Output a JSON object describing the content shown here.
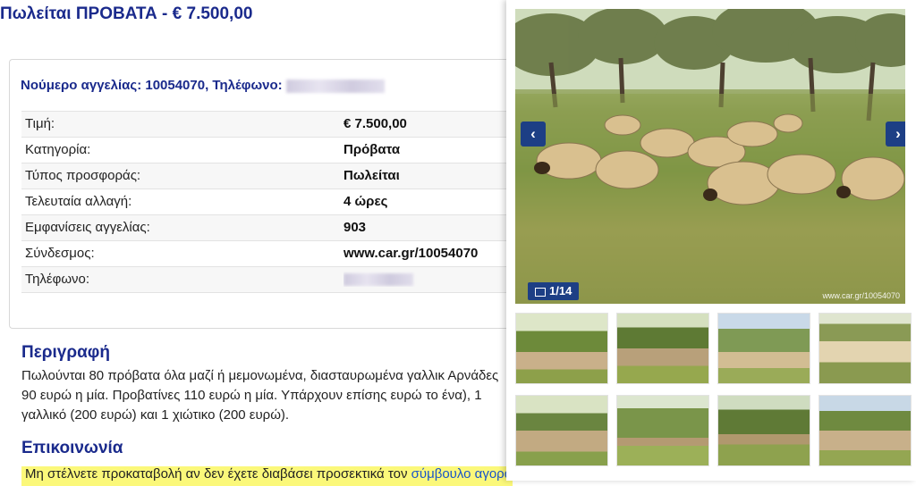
{
  "listing": {
    "title": "Πωλείται  ΠΡΟΒΑΤΑ - € 7.500,00",
    "ad_number_text": "Νούμερο αγγελίας: 10054070, Τηλέφωνο:"
  },
  "info_rows": [
    {
      "label": "Τιμή:",
      "value": "€ 7.500,00"
    },
    {
      "label": "Κατηγορία:",
      "value": "Πρόβατα"
    },
    {
      "label": "Τύπος προσφοράς:",
      "value": "Πωλείται"
    },
    {
      "label": "Τελευταία αλλαγή:",
      "value": "4 ώρες"
    },
    {
      "label": "Εμφανίσεις αγγελίας:",
      "value": "903"
    },
    {
      "label": "Σύνδεσμος:",
      "value": "www.car.gr/10054070"
    },
    {
      "label": "Τηλέφωνο:",
      "value": ""
    }
  ],
  "description": {
    "heading": "Περιγραφή",
    "text": "Πωλούνται 80 πρόβατα όλα μαζί ή μεμονωμένα, διασταυρωμένα γαλλικ Αρνάδες 90 ευρώ η μία. Προβατίνες 110 ευρώ η μία. Υπάρχουν επίσης ευρώ το ένα), 1 γαλλικό (200 ευρώ) και 1 χιώτικο (200 ευρώ)."
  },
  "contact": {
    "heading": "Επικοινωνία",
    "warning_text": "Μη στέλνετε προκαταβολή αν δεν έχετε διαβάσει προσεκτικά τον ",
    "warning_link": "σύμβουλο αγοράς!"
  },
  "gallery": {
    "counter": "1/14",
    "watermark": "www.car.gr/10054070",
    "prev_icon": "chevron-left-icon",
    "next_icon": "chevron-right-icon",
    "counter_icon": "image-icon",
    "thumbnail_count": 8
  },
  "colors": {
    "heading": "#1a2a8c",
    "nav_button": "#1d3f85",
    "warning_bg": "#fbf87a",
    "link": "#1a55c8"
  }
}
